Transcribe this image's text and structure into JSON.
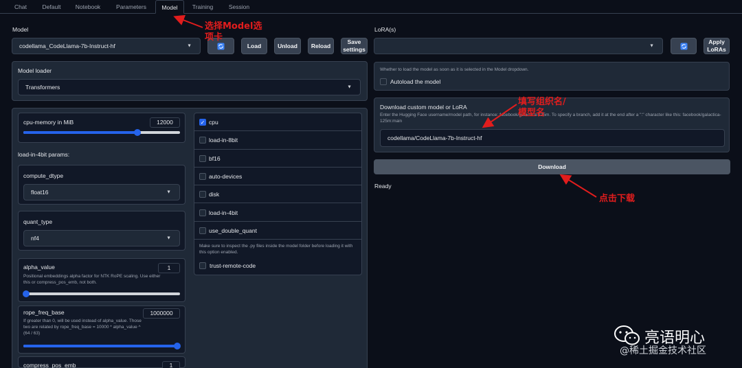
{
  "tabs": [
    "Chat",
    "Default",
    "Notebook",
    "Parameters",
    "Model",
    "Training",
    "Session"
  ],
  "model": {
    "label": "Model",
    "selected": "codellama_CodeLlama-7b-Instruct-hf",
    "buttons": {
      "load": "Load",
      "unload": "Unload",
      "reload": "Reload",
      "save": "Save settings"
    }
  },
  "lora": {
    "label": "LoRA(s)",
    "selected": "",
    "apply": "Apply LoRAs"
  },
  "loader": {
    "label": "Model loader",
    "selected": "Transformers"
  },
  "autoload": {
    "info": "Whether to load the model as soon as it is selected in the Model dropdown.",
    "label": "Autoload the model"
  },
  "download": {
    "label": "Download custom model or LoRA",
    "info": "Enter the Hugging Face username/model path, for instance: facebook/galactica-125m. To specify a branch, add it at the end after a \":\" character like this: facebook/galactica-125m:main",
    "value": "codellama/CodeLlama-7b-Instruct-hf",
    "button": "Download",
    "status": "Ready"
  },
  "params": {
    "cpu_memory": {
      "label": "cpu-memory in MiB",
      "value": "12000",
      "fraction": 0.73
    },
    "load4bit_header": "load-in-4bit params:",
    "compute_dtype": {
      "label": "compute_dtype",
      "value": "float16"
    },
    "quant_type": {
      "label": "quant_type",
      "value": "nf4"
    },
    "alpha_value": {
      "label": "alpha_value",
      "value": "1",
      "info": "Positional embeddings alpha factor for NTK RoPE scaling. Use either this or compress_pos_emb, not both.",
      "fraction": 0.0
    },
    "rope_freq_base": {
      "label": "rope_freq_base",
      "value": "1000000",
      "info": "If greater than 0, will be used instead of alpha_value. Those two are related by rope_freq_base = 10000 * alpha_value ^ (64 / 63)",
      "fraction": 1.0
    },
    "compress_pos_emb": {
      "label": "compress_pos_emb",
      "value": "1"
    }
  },
  "checkboxes": [
    {
      "label": "cpu",
      "checked": true
    },
    {
      "label": "load-in-8bit",
      "checked": false
    },
    {
      "label": "bf16",
      "checked": false
    },
    {
      "label": "auto-devices",
      "checked": false
    },
    {
      "label": "disk",
      "checked": false
    },
    {
      "label": "load-in-4bit",
      "checked": false
    },
    {
      "label": "use_double_quant",
      "checked": false
    }
  ],
  "trust": {
    "note": "Make sure to inspect the .py files inside the model folder before loading it with this option enabled.",
    "label": "trust-remote-code"
  },
  "annotations": {
    "tab_note": "选择Model选项卡",
    "name_note": "填写组织名/模型名",
    "download_note": "点击下载"
  },
  "watermark": {
    "brand": "亮语明心",
    "site": "@稀土掘金技术社区"
  },
  "icons": {
    "refresh": "refresh-icon",
    "caret": "chevron-down-icon",
    "check": "check-icon"
  },
  "colors": {
    "background": "#0b0f19",
    "panel": "#1f2937",
    "accent": "#2563eb",
    "annotation": "#e11d1d"
  }
}
